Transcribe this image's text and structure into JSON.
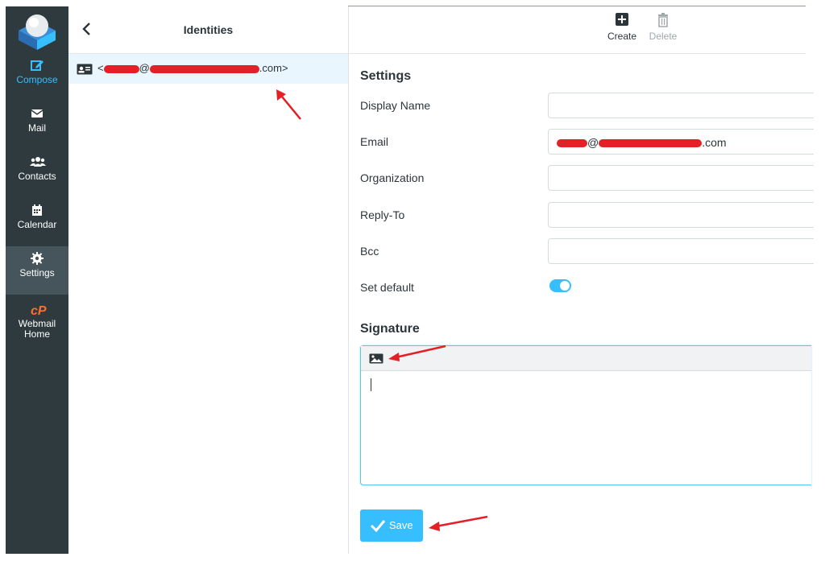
{
  "sidebar": {
    "items": [
      {
        "id": "compose",
        "label": "Compose",
        "icon": "compose-icon"
      },
      {
        "id": "mail",
        "label": "Mail",
        "icon": "envelope-icon"
      },
      {
        "id": "contacts",
        "label": "Contacts",
        "icon": "users-icon"
      },
      {
        "id": "calendar",
        "label": "Calendar",
        "icon": "calendar-icon"
      },
      {
        "id": "settings",
        "label": "Settings",
        "icon": "gear-icon"
      },
      {
        "id": "webmail-home",
        "label": "Webmail\nHome",
        "icon": "cpanel-logo-icon"
      }
    ]
  },
  "identities": {
    "title": "Identities",
    "row": {
      "prefix": "<",
      "at": "@",
      "suffix": ".com>"
    }
  },
  "toolbar": {
    "create_label": "Create",
    "delete_label": "Delete"
  },
  "settings": {
    "title": "Settings",
    "display_name_label": "Display Name",
    "email_label": "Email",
    "email_at": "@",
    "email_suffix": ".com",
    "organization_label": "Organization",
    "reply_to_label": "Reply-To",
    "bcc_label": "Bcc",
    "set_default_label": "Set default",
    "set_default_on": true
  },
  "signature": {
    "title": "Signature"
  },
  "save_label": "Save",
  "colors": {
    "sidebar_bg": "#2f3a3f",
    "accent": "#37beff",
    "redaction": "#e32028",
    "arrow": "#e32028"
  }
}
